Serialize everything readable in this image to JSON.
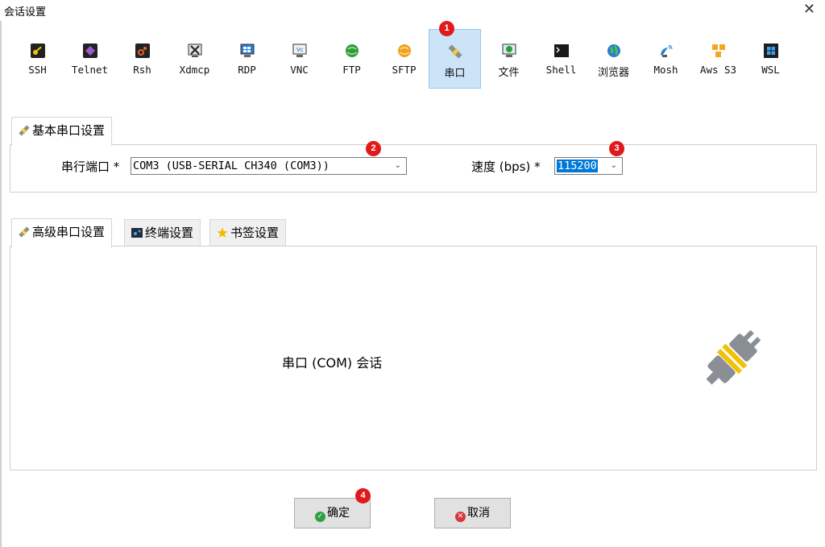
{
  "window": {
    "title": "会话设置"
  },
  "toolbar": {
    "items": [
      {
        "label": "SSH",
        "icon": "ssh-key-icon"
      },
      {
        "label": "Telnet",
        "icon": "telnet-icon"
      },
      {
        "label": "Rsh",
        "icon": "rsh-icon"
      },
      {
        "label": "Xdmcp",
        "icon": "xdmcp-icon"
      },
      {
        "label": "RDP",
        "icon": "rdp-monitor-icon"
      },
      {
        "label": "VNC",
        "icon": "vnc-icon"
      },
      {
        "label": "FTP",
        "icon": "ftp-globe-icon"
      },
      {
        "label": "SFTP",
        "icon": "sftp-icon"
      },
      {
        "label": "串口",
        "icon": "serial-plug-icon"
      },
      {
        "label": "文件",
        "icon": "file-monitor-icon"
      },
      {
        "label": "Shell",
        "icon": "shell-terminal-icon"
      },
      {
        "label": "浏览器",
        "icon": "browser-globe-icon"
      },
      {
        "label": "Mosh",
        "icon": "mosh-satellite-icon"
      },
      {
        "label": "Aws S3",
        "icon": "aws-s3-icon"
      },
      {
        "label": "WSL",
        "icon": "wsl-windows-icon"
      }
    ],
    "selected_index": 8
  },
  "badges": [
    "1",
    "2",
    "3",
    "4"
  ],
  "basic": {
    "tab_label": "基本串口设置",
    "port_label": "串行端口 *",
    "port_value": "COM3  (USB-SERIAL CH340 (COM3))",
    "speed_label": "速度 (bps) *",
    "speed_value": "115200"
  },
  "tabs": [
    {
      "label": "高级串口设置",
      "icon": "serial-plug-icon"
    },
    {
      "label": "终端设置",
      "icon": "terminal-icon"
    },
    {
      "label": "书签设置",
      "icon": "star-icon"
    }
  ],
  "content": {
    "session_text": "串口 (COM) 会话"
  },
  "buttons": {
    "ok": "确定",
    "cancel": "取消"
  },
  "colors": {
    "badge": "#e0191b",
    "selected_bg": "#cce4f7",
    "highlight": "#0078d7",
    "ok_icon": "#2ea043",
    "cancel_icon": "#d9363e"
  }
}
